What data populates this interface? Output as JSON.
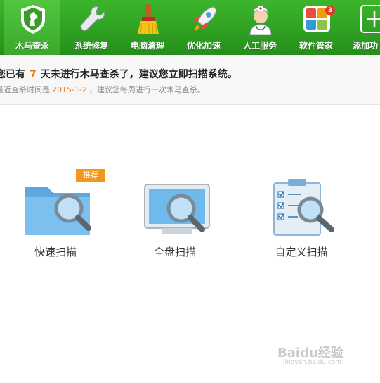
{
  "toolbar": {
    "items": [
      {
        "label": "木马查杀",
        "icon": "horse-shield-icon",
        "active": true
      },
      {
        "label": "系统修复",
        "icon": "wrench-icon"
      },
      {
        "label": "电脑清理",
        "icon": "broom-icon"
      },
      {
        "label": "优化加速",
        "icon": "rocket-icon"
      },
      {
        "label": "人工服务",
        "icon": "doctor-icon"
      },
      {
        "label": "软件管家",
        "icon": "app-grid-icon",
        "badge": "3"
      },
      {
        "label": "添加功",
        "icon": "plus-icon"
      }
    ]
  },
  "banner": {
    "prefix": "您已有",
    "days": "7",
    "suffix": "天未进行木马查杀了，建议您立即扫描系统。",
    "sub_prefix": "最近查杀时间是",
    "last_date": "2015-1-2",
    "sub_suffix": "，建议您每周进行一次木马查杀。"
  },
  "scan": {
    "recommend_tag": "推荐",
    "options": [
      {
        "label": "快速扫描",
        "icon": "folder-magnifier-icon"
      },
      {
        "label": "全盘扫描",
        "icon": "monitor-magnifier-icon"
      },
      {
        "label": "自定义扫描",
        "icon": "checklist-magnifier-icon"
      }
    ]
  },
  "watermark": {
    "text": "Baidu经验",
    "sub": "jingyan.baidu.com"
  },
  "colors": {
    "toolbar_green": "#2e9f22",
    "accent_orange": "#e07a10",
    "tag_orange": "#f2971c"
  }
}
